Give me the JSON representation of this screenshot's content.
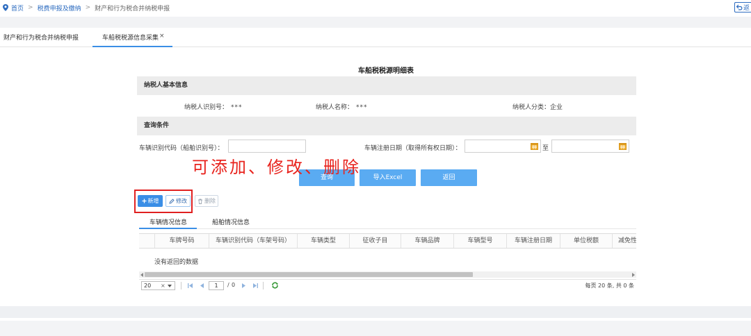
{
  "breadcrumb": {
    "items": [
      "首页",
      "税费申报及缴纳",
      "财产和行为税合并纳税申报"
    ],
    "separator": ">"
  },
  "back_button": {
    "label": "返"
  },
  "tabs": [
    {
      "label": "财产和行为税合并纳税申报"
    },
    {
      "label": "车船税税源信息采集",
      "close": "×"
    }
  ],
  "page_title": "车船税税源明细表",
  "taxpayer_section": {
    "title": "纳税人基本信息",
    "fields": [
      {
        "label": "纳税人识别号：",
        "value": "***"
      },
      {
        "label": "纳税人名称：",
        "value": "***"
      },
      {
        "label": "纳税人分类：",
        "value": "企业"
      }
    ]
  },
  "query_section": {
    "title": "查询条件",
    "vin_label": "车辆识别代码（船舶识别号）：",
    "vin_value": "",
    "reg_date_label": "车辆注册日期（取得所有权日期）：",
    "date_from": "",
    "to_label": "至",
    "date_to": ""
  },
  "annotation": {
    "text": "可添加、修改、删除"
  },
  "query_buttons": {
    "search": "查询",
    "import": "导入Excel",
    "back": "返回"
  },
  "toolbar": {
    "add": "新增",
    "edit": "修改",
    "delete": "删除"
  },
  "sub_tabs": [
    {
      "label": "车辆情况信息"
    },
    {
      "label": "船舶情况信息"
    }
  ],
  "table": {
    "columns": [
      "车牌号码",
      "车辆识别代码（车架号码）",
      "车辆类型",
      "征收子目",
      "车辆品牌",
      "车辆型号",
      "车辆注册日期",
      "单位税额",
      "减免性"
    ],
    "empty_text": "没有返回的数据"
  },
  "pagination": {
    "page_size": "20",
    "clear": "×",
    "current_page": "1",
    "of_text": "/",
    "total_pages": "0",
    "summary": "每页 20 条, 共 0 条"
  },
  "icons": [
    "location-pin-icon",
    "back-arrow-icon",
    "close-icon",
    "calendar-icon",
    "plus-icon",
    "pencil-icon",
    "trash-icon",
    "first-page-icon",
    "prev-page-icon",
    "next-page-icon",
    "last-page-icon",
    "refresh-icon"
  ],
  "colors": {
    "primary": "#3a8ee6",
    "link": "#2d6cc0",
    "query_button": "#5aabf2",
    "annotation": "#e8231d",
    "section_header": "#ececec",
    "calendar": "#f0b030",
    "refresh": "#3a9a3a"
  }
}
